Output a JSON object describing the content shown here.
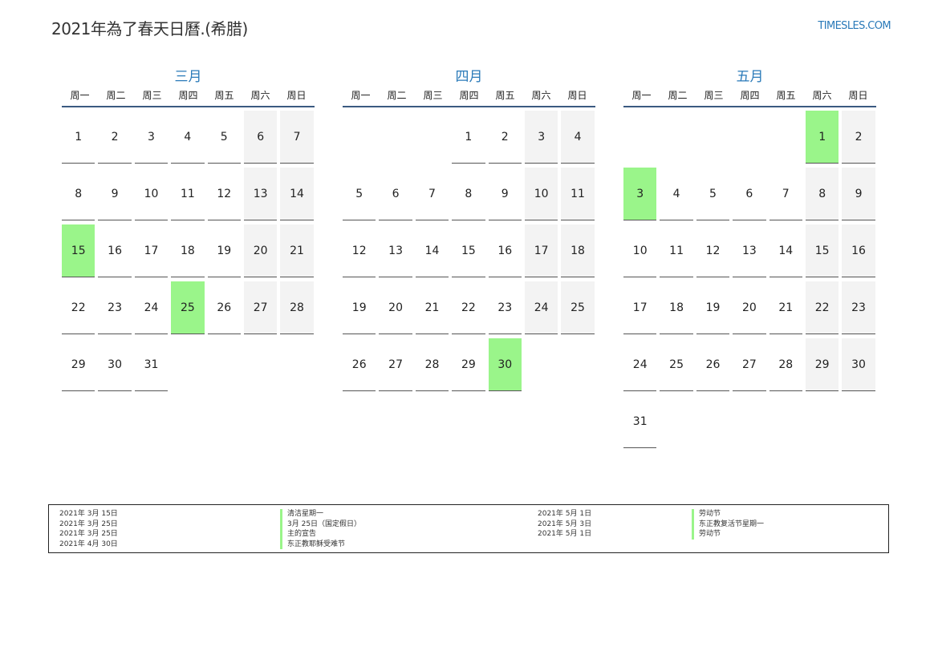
{
  "header": {
    "title": "2021年為了春天日曆.(希腊)",
    "site": "TIMESLES.COM"
  },
  "colors": {
    "accent": "#2a7ab9",
    "holiday": "#9af58a",
    "weekend": "#f3f3f3",
    "rule": "#3b5a80"
  },
  "weekdays": [
    "周一",
    "周二",
    "周三",
    "周四",
    "周五",
    "周六",
    "周日"
  ],
  "months": [
    {
      "name": "三月",
      "offset": 0,
      "days": 31,
      "holidays": [
        15,
        25
      ]
    },
    {
      "name": "四月",
      "offset": 3,
      "days": 30,
      "holidays": [
        30
      ]
    },
    {
      "name": "五月",
      "offset": 5,
      "days": 31,
      "holidays": [
        1,
        3
      ]
    }
  ],
  "legend": {
    "left": [
      {
        "date": "2021年 3月 15日",
        "name": "清洁星期一"
      },
      {
        "date": "2021年 3月 25日",
        "name": "3月 25日（国定假日）"
      },
      {
        "date": "2021年 3月 25日",
        "name": "主的宣告"
      },
      {
        "date": "2021年 4月 30日",
        "name": "东正教耶稣受难节"
      }
    ],
    "right": [
      {
        "date": "2021年 5月 1日",
        "name": "劳动节"
      },
      {
        "date": "2021年 5月 3日",
        "name": "东正教复活节星期一"
      },
      {
        "date": "2021年 5月 1日",
        "name": "劳动节"
      }
    ]
  }
}
